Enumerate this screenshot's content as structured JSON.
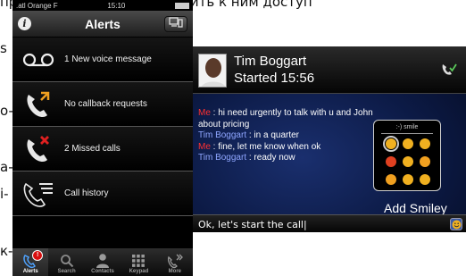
{
  "background_text": {
    "top": "приложениям и предоставить к ним доступ",
    "l1": "s",
    "l2": "o-",
    "l3": "а-",
    "l4": "i-",
    "l5": "к-"
  },
  "alerts_screen": {
    "status_bar": {
      "carrier": ".atl Orange F",
      "time": "15:10"
    },
    "nav": {
      "title": "Alerts",
      "info_label": "i",
      "device_label": "▭"
    },
    "rows": [
      {
        "label": "1 New voice message",
        "icon": "voicemail-icon"
      },
      {
        "label": "No callback requests",
        "icon": "callback-icon"
      },
      {
        "label": "2  Missed calls",
        "icon": "missed-call-icon"
      },
      {
        "label": "Call history",
        "icon": "call-history-icon"
      }
    ],
    "tabs": [
      {
        "label": "Alerts",
        "icon": "phone-icon",
        "badge": "!"
      },
      {
        "label": "Search",
        "icon": "search-icon"
      },
      {
        "label": "Contacts",
        "icon": "contacts-icon"
      },
      {
        "label": "Keypad",
        "icon": "keypad-icon"
      },
      {
        "label": "More",
        "icon": "more-icon"
      }
    ],
    "colors": {
      "badge": "#d81010",
      "callback_arrow": "#f0a020",
      "missed_x": "#e02020"
    }
  },
  "chat_screen": {
    "contact": {
      "name": "Tim Boggart",
      "started": "Started 15:56"
    },
    "messages": [
      {
        "sender": "Me",
        "text": " : hi need urgently to talk with u and John about pricing"
      },
      {
        "sender": "Tim Boggart",
        "text": " : in a quarter"
      },
      {
        "sender": "Me",
        "text": " : fine, let me know when ok"
      },
      {
        "sender": "Tim Boggart",
        "text": " : ready now"
      }
    ],
    "smiley_panel": {
      "hint": ":-) smile",
      "add_label": "Add Smiley"
    },
    "compose": {
      "value": "Ok, let's start the call|"
    },
    "colors": {
      "me": "#ff3030",
      "tim": "#8fa6ff",
      "background": "#0c1a45"
    }
  }
}
